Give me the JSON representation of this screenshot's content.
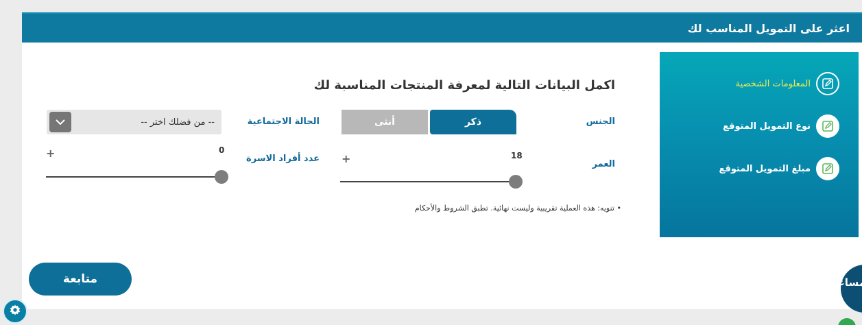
{
  "header": {
    "title": "اعثر على التمويل المناسب لك"
  },
  "steps": [
    {
      "label": "المعلومات الشخصية",
      "state": "active",
      "icon": "edit-icon"
    },
    {
      "label": "نوع التمويل المتوقع",
      "state": "inactive",
      "icon": "edit-icon"
    },
    {
      "label": "مبلغ التمويل المتوقع",
      "state": "inactive",
      "icon": "edit-icon"
    }
  ],
  "form": {
    "title": "اكمل البيانات التالية لمعرفة المنتجات المناسبة لك",
    "gender": {
      "label": "الجنس",
      "options": [
        "ذكر",
        "أنثى"
      ],
      "selected": "ذكر"
    },
    "marital": {
      "label": "الحالة الاجتماعية",
      "placeholder": "-- من فضلك اختر --"
    },
    "age": {
      "label": "العمر",
      "value": "18",
      "plus": "+"
    },
    "family": {
      "label": "عدد أفراد الاسرة",
      "value": "0",
      "plus": "+"
    },
    "note": "تنويه: هذه العملية تقريبية وليست نهائية. تطبق الشروط والأحكام",
    "note_bullet": "•"
  },
  "actions": {
    "continue_label": "متابعة"
  },
  "assistant": {
    "label": "مساعد ذكي"
  },
  "colors": {
    "header": "#0e7aa0",
    "panel_top": "#06a7b8",
    "panel_bottom": "#06759d",
    "primary_button": "#0e6f98",
    "active_step": "#f2e94e"
  }
}
